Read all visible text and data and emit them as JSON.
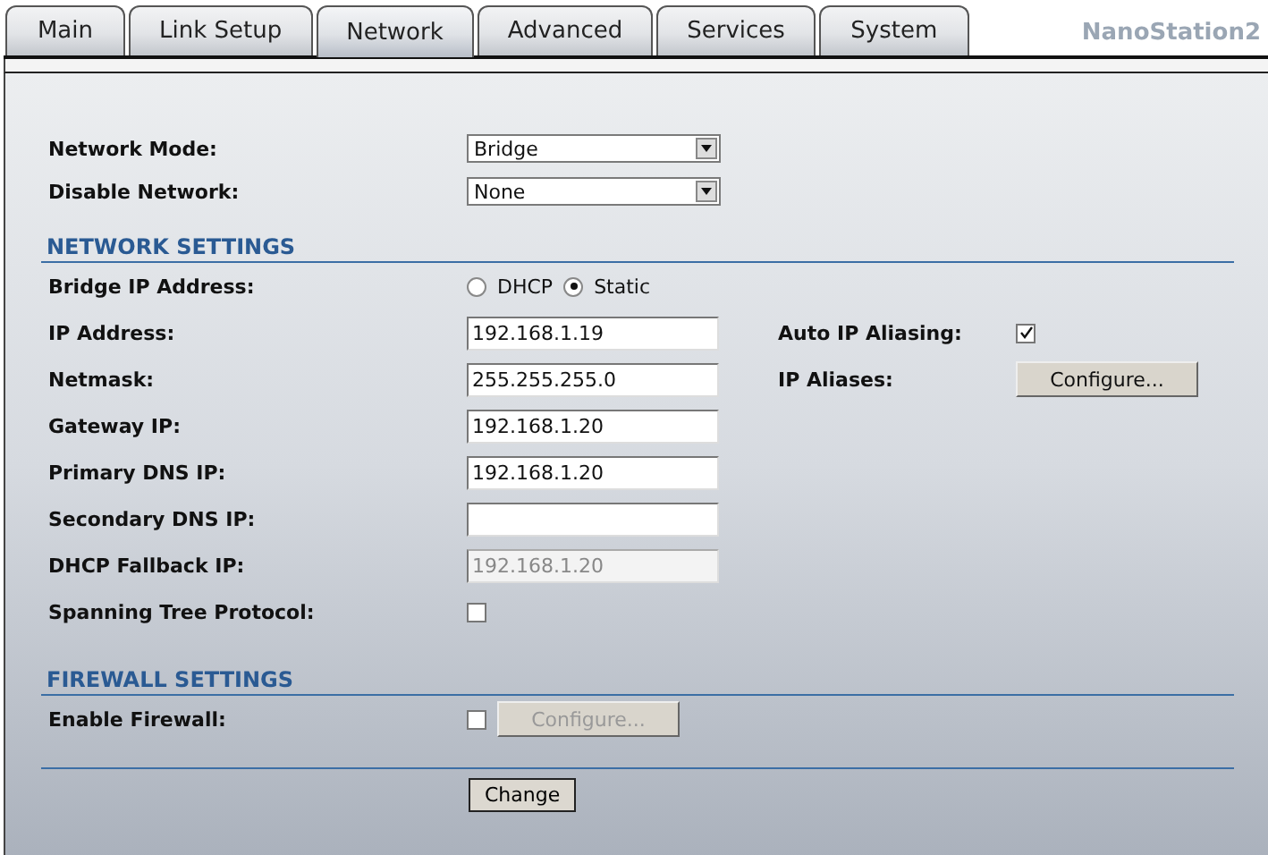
{
  "tabs": [
    {
      "label": "Main",
      "selected": false
    },
    {
      "label": "Link Setup",
      "selected": false
    },
    {
      "label": "Network",
      "selected": true
    },
    {
      "label": "Advanced",
      "selected": false
    },
    {
      "label": "Services",
      "selected": false
    },
    {
      "label": "System",
      "selected": false
    }
  ],
  "brand": {
    "product": "NanoStation2"
  },
  "mode_fields": [
    {
      "label": "Network Mode:",
      "value": "Bridge"
    },
    {
      "label": "Disable Network:",
      "value": "None"
    }
  ],
  "network_settings": {
    "title": "NETWORK SETTINGS",
    "rows": [
      {
        "label": "Bridge IP Address:",
        "kind": "radio",
        "options": [
          {
            "label": "DHCP",
            "selected": false
          },
          {
            "label": "Static",
            "selected": true
          }
        ]
      },
      {
        "label": "IP Address:",
        "kind": "text",
        "value": "192.168.1.19",
        "disabled": false,
        "side": {
          "label": "Auto IP Aliasing:",
          "kind": "checkbox",
          "checked": true
        }
      },
      {
        "label": "Netmask:",
        "kind": "text",
        "value": "255.255.255.0",
        "disabled": false,
        "side": {
          "label": "IP Aliases:",
          "kind": "button",
          "button": "Configure..."
        }
      },
      {
        "label": "Gateway IP:",
        "kind": "text",
        "value": "192.168.1.20",
        "disabled": false
      },
      {
        "label": "Primary DNS IP:",
        "kind": "text",
        "value": "192.168.1.20",
        "disabled": false
      },
      {
        "label": "Secondary DNS IP:",
        "kind": "text",
        "value": "",
        "disabled": false
      },
      {
        "label": "DHCP Fallback IP:",
        "kind": "text",
        "value": "192.168.1.20",
        "disabled": true
      },
      {
        "label": "Spanning Tree Protocol:",
        "kind": "checkbox",
        "checked": false
      }
    ]
  },
  "firewall_settings": {
    "title": "FIREWALL SETTINGS",
    "rows": [
      {
        "label": "Enable Firewall:",
        "kind": "checkbox",
        "checked": false,
        "button": {
          "label": "Configure...",
          "disabled": true
        }
      }
    ]
  },
  "submit": "Change"
}
